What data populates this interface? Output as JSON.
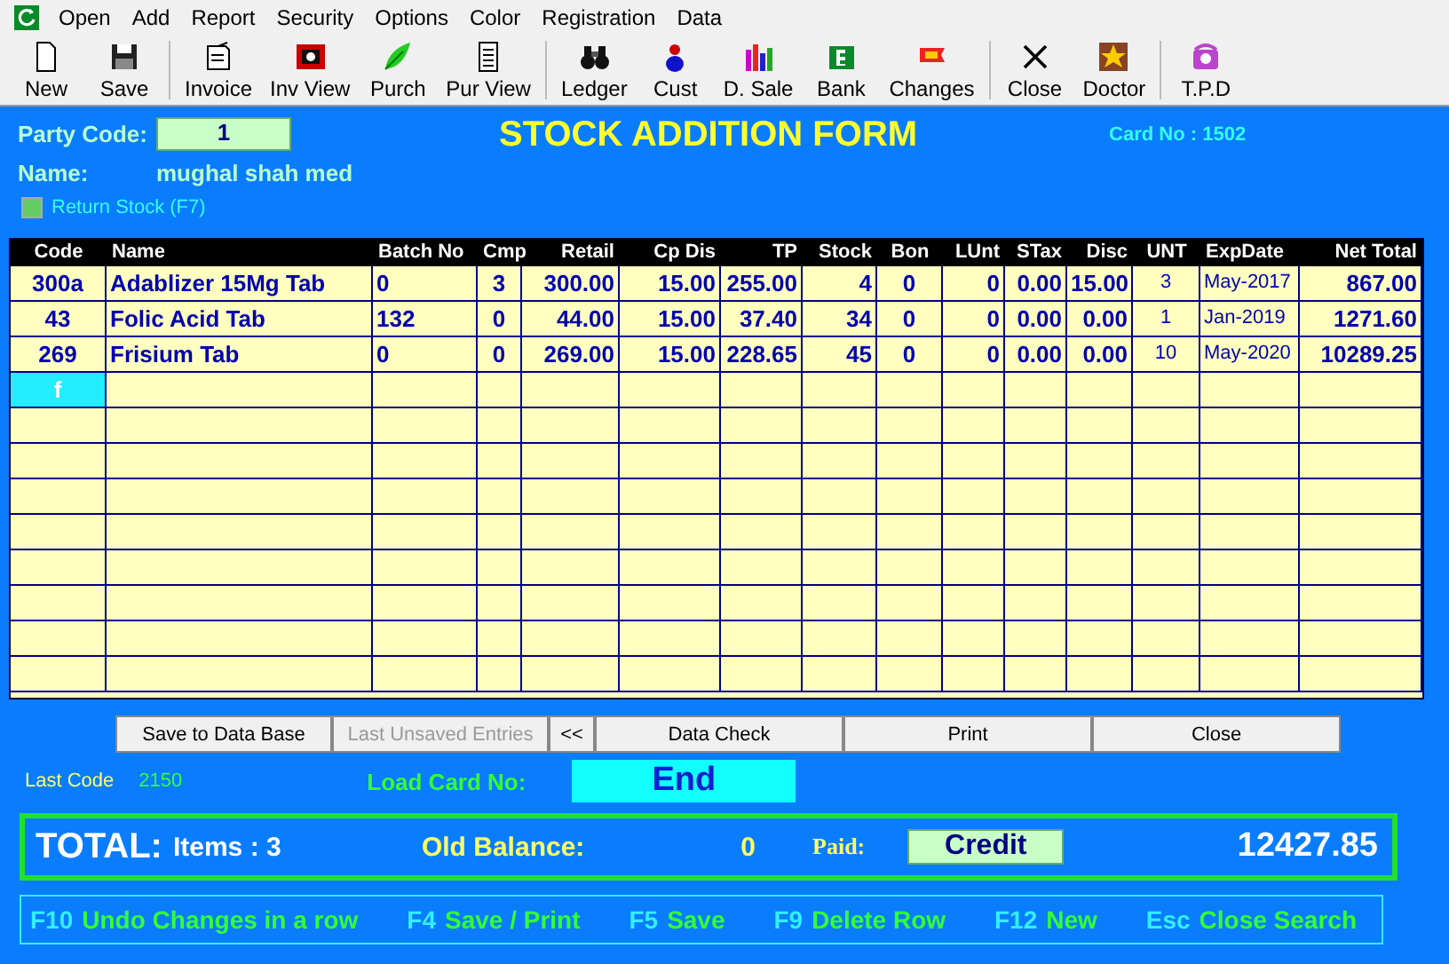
{
  "menu": [
    "Open",
    "Add",
    "Report",
    "Security",
    "Options",
    "Color",
    "Registration",
    "Data"
  ],
  "toolbar": [
    {
      "label": "New",
      "kind": "page"
    },
    {
      "label": "Save",
      "kind": "disk"
    },
    {
      "label": "Invoice",
      "kind": "invoice"
    },
    {
      "label": "Inv View",
      "kind": "film"
    },
    {
      "label": "Purch",
      "kind": "leaf"
    },
    {
      "label": "Pur View",
      "kind": "document"
    },
    {
      "label": "Ledger",
      "kind": "binoculars"
    },
    {
      "label": "Cust",
      "kind": "person"
    },
    {
      "label": "D. Sale",
      "kind": "bars"
    },
    {
      "label": "Bank",
      "kind": "bank"
    },
    {
      "label": "Changes",
      "kind": "flag"
    },
    {
      "label": "Close",
      "kind": "x"
    },
    {
      "label": "Doctor",
      "kind": "star"
    },
    {
      "label": "T.P.D",
      "kind": "phone"
    }
  ],
  "form": {
    "party_code_label": "Party Code:",
    "party_code": "1",
    "title": "STOCK ADDITION FORM",
    "card_no": "Card No : 1502",
    "name_label": "Name:",
    "name": "mughal shah med",
    "return_stock": {
      "label": "Return Stock  (F7)",
      "checked": false
    }
  },
  "table": {
    "columns": [
      "Code",
      "Name",
      "Batch No",
      "Cmp",
      "Retail",
      "Cp Dis",
      "TP",
      "Stock",
      "Bon",
      "LUnt",
      "STax",
      "Disc",
      "UNT",
      "ExpDate",
      "Net Total"
    ],
    "rows": [
      {
        "editing": false,
        "cells": [
          "300a",
          "Adablizer 15Mg Tab",
          "0",
          "3",
          "300.00",
          "15.00",
          "255.00",
          "4",
          "0",
          "0",
          "0.00",
          "15.00",
          "3",
          "May-2017",
          "867.00"
        ]
      },
      {
        "editing": false,
        "cells": [
          "43",
          "Folic Acid Tab",
          "132",
          "0",
          "44.00",
          "15.00",
          "37.40",
          "34",
          "0",
          "0",
          "0.00",
          "0.00",
          "1",
          "Jan-2019",
          "1271.60"
        ]
      },
      {
        "editing": false,
        "cells": [
          "269",
          "Frisium Tab",
          "0",
          "0",
          "269.00",
          "15.00",
          "228.65",
          "45",
          "0",
          "0",
          "0.00",
          "0.00",
          "10",
          "May-2020",
          "10289.25"
        ]
      },
      {
        "editing": true,
        "cells": [
          "f"
        ]
      }
    ]
  },
  "buttons": [
    {
      "label": "Save to Data Base",
      "disabled": false
    },
    {
      "label": "Last Unsaved Entries",
      "disabled": true
    },
    {
      "label": "<<",
      "disabled": false
    },
    {
      "label": "Data Check",
      "disabled": false
    },
    {
      "label": "Print",
      "disabled": false
    },
    {
      "label": "Close",
      "disabled": false
    }
  ],
  "last_code_label": "Last Code",
  "last_code": "2150",
  "load_card_label": "Load Card No:",
  "load_card": "End",
  "totals": {
    "total_label": "TOTAL:",
    "items": "Items : 3",
    "old_balance_label": "Old Balance:",
    "old_balance": "0",
    "paid_label": "Paid:",
    "paid": "Credit",
    "grand_total": "12427.85"
  },
  "hotkeys": [
    {
      "key": "F10",
      "label": "Undo Changes in a row"
    },
    {
      "key": "F4",
      "label": "Save / Print"
    },
    {
      "key": "F5",
      "label": "Save"
    },
    {
      "key": "F9",
      "label": "Delete Row"
    },
    {
      "key": "F12",
      "label": "New"
    },
    {
      "key": "Esc",
      "label": "Close Search"
    }
  ]
}
